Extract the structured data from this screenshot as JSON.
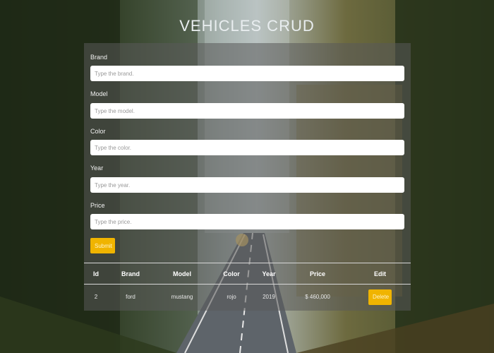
{
  "page": {
    "title": "VEHICLES CRUD"
  },
  "form": {
    "fields": [
      {
        "label": "Brand",
        "placeholder": "Type the brand."
      },
      {
        "label": "Model",
        "placeholder": "Type the model."
      },
      {
        "label": "Color",
        "placeholder": "Type the color."
      },
      {
        "label": "Year",
        "placeholder": "Type the year."
      },
      {
        "label": "Price",
        "placeholder": "Type the price."
      }
    ],
    "submit_label": "Submit"
  },
  "table": {
    "headers": [
      "Id",
      "Brand",
      "Model",
      "Color",
      "Year",
      "Price",
      "Edit"
    ],
    "rows": [
      {
        "id": "2",
        "brand": "ford",
        "model": "mustang",
        "color": "rojo",
        "year": "2019",
        "price": "$ 460,000",
        "action_label": "Delete"
      }
    ]
  },
  "colors": {
    "accent": "#f0b400",
    "panel": "rgba(90,90,90,0.55)"
  }
}
